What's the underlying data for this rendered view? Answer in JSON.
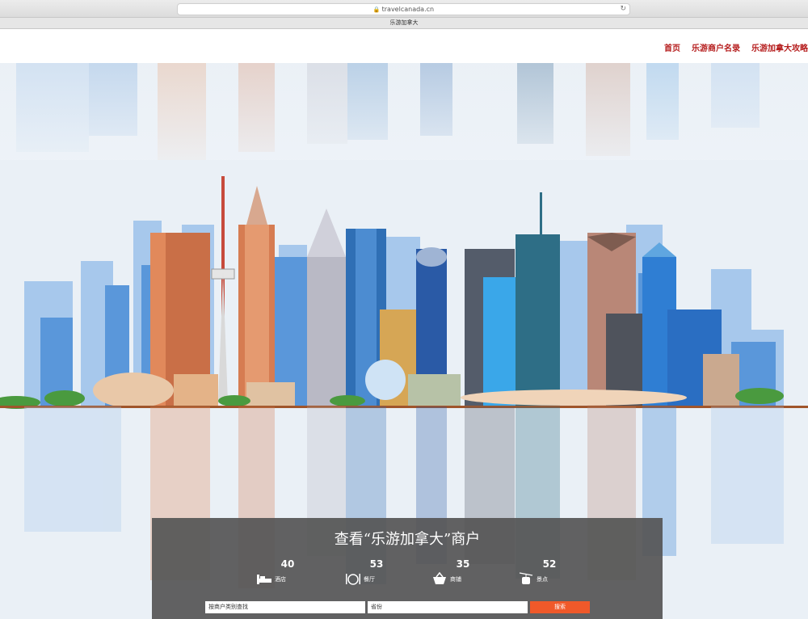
{
  "browser": {
    "url": "travelcanada.cn",
    "tab_title": "乐游加拿大"
  },
  "nav": {
    "items": [
      "首页",
      "乐游商户名录",
      "乐游加拿大攻略"
    ]
  },
  "panel": {
    "title": "查看“乐游加拿大”商户",
    "stats": [
      {
        "count": "40",
        "label": "酒店",
        "icon": "bed-icon"
      },
      {
        "count": "53",
        "label": "餐厅",
        "icon": "dining-icon"
      },
      {
        "count": "35",
        "label": "商铺",
        "icon": "shopping-basket-icon"
      },
      {
        "count": "52",
        "label": "景点",
        "icon": "cable-car-icon"
      }
    ],
    "category_field": "按商户类别查找",
    "province_field": "省份",
    "search_label": "搜索"
  },
  "colors": {
    "nav_text": "#b51c1c",
    "search_button": "#f0592a",
    "panel_bg": "#555555"
  }
}
